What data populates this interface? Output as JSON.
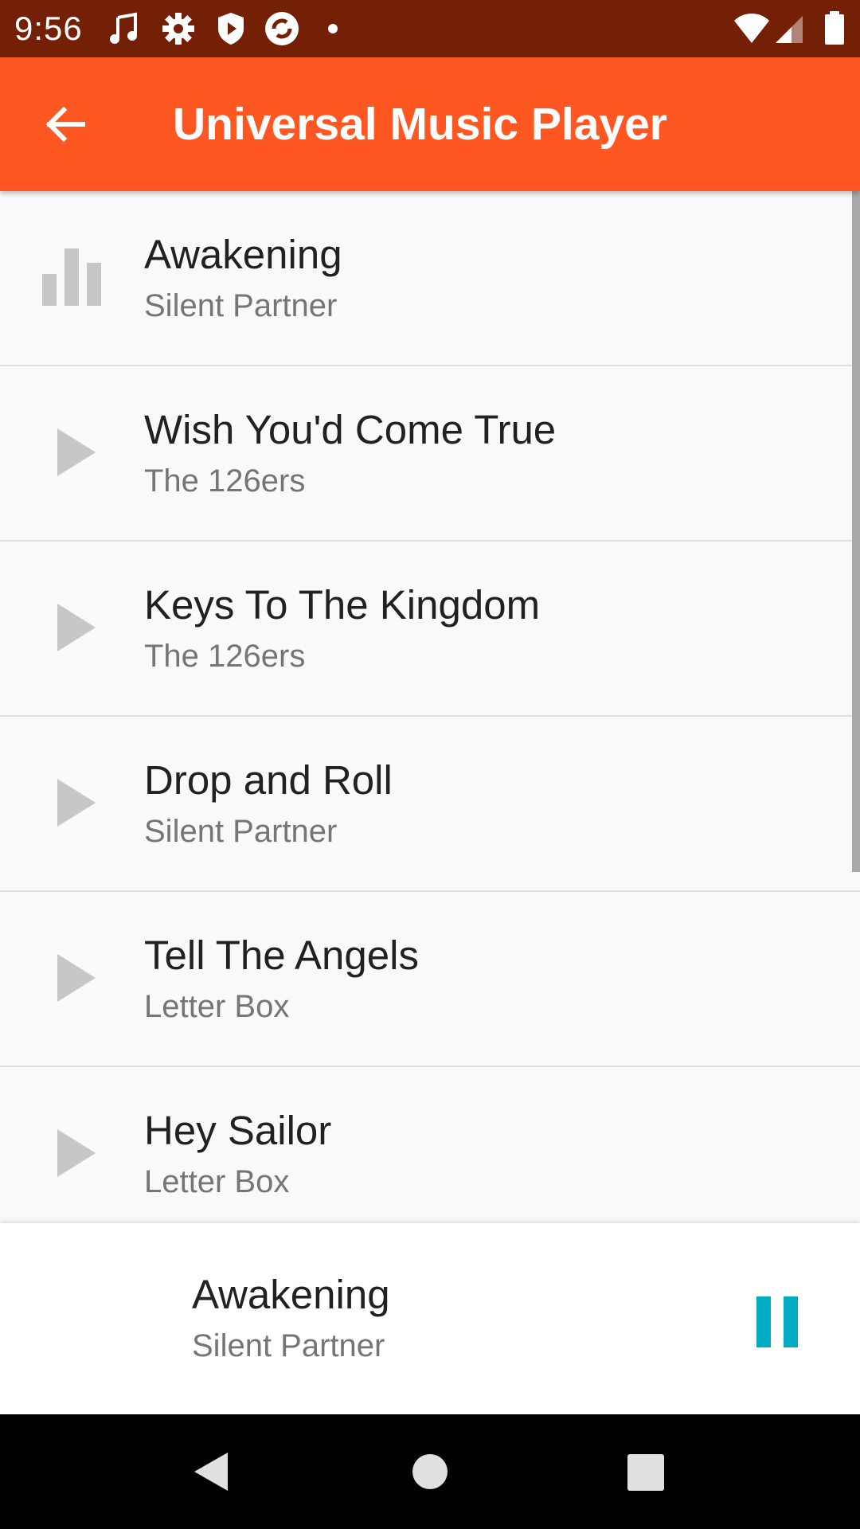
{
  "status_bar": {
    "time": "9:56",
    "left_icons": [
      "music-note-icon",
      "gear-icon",
      "shield-icon",
      "sync-icon",
      "dot-icon"
    ],
    "right_icons": [
      "wifi-icon",
      "signal-icon",
      "battery-icon"
    ]
  },
  "app_bar": {
    "title": "Universal Music Player",
    "back_icon": "arrow-back-icon",
    "color": "#ff5722",
    "status_color": "#732006"
  },
  "tracks": [
    {
      "title": "Awakening",
      "artist": "Silent Partner",
      "state": "playing",
      "icon": "equalizer-icon"
    },
    {
      "title": "Wish You'd Come True",
      "artist": "The 126ers",
      "state": "idle",
      "icon": "play-icon"
    },
    {
      "title": "Keys To The Kingdom",
      "artist": "The 126ers",
      "state": "idle",
      "icon": "play-icon"
    },
    {
      "title": "Drop and Roll",
      "artist": "Silent Partner",
      "state": "idle",
      "icon": "play-icon"
    },
    {
      "title": "Tell The Angels",
      "artist": "Letter Box",
      "state": "idle",
      "icon": "play-icon"
    },
    {
      "title": "Hey Sailor",
      "artist": "Letter Box",
      "state": "idle",
      "icon": "play-icon"
    }
  ],
  "now_playing": {
    "title": "Awakening",
    "artist": "Silent Partner",
    "control_icon": "pause-icon",
    "accent": "#00acc1"
  },
  "nav_bar": {
    "icons": [
      "back-triangle-icon",
      "home-circle-icon",
      "recents-square-icon"
    ]
  }
}
